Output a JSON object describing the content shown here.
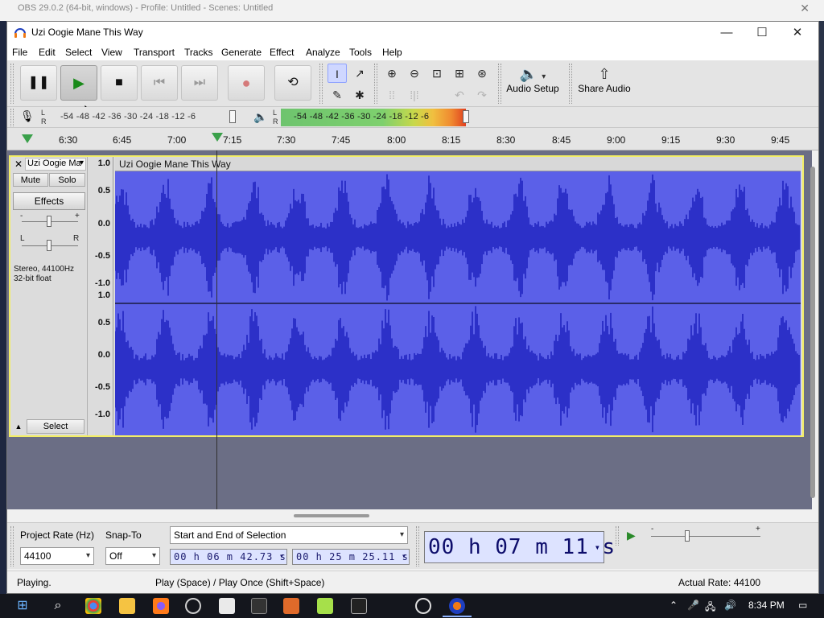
{
  "background": {
    "title": "OBS 29.0.2 (64-bit, windows) - Profile: Untitled - Scenes: Untitled",
    "close_glyph": "✕"
  },
  "window": {
    "title": "Uzi Oogie Mane This Way",
    "minimize": "—",
    "maximize": "☐",
    "close": "✕"
  },
  "menu": [
    "File",
    "Edit",
    "Select",
    "View",
    "Transport",
    "Tracks",
    "Generate",
    "Effect",
    "Analyze",
    "Tools",
    "Help"
  ],
  "transport": {
    "pause": "❚❚",
    "play": "▶",
    "stop": "■",
    "skip_start": "⏮",
    "skip_end": "⏭",
    "record": "●",
    "loop": "⟲"
  },
  "tools": {
    "select": "I",
    "envelope": "↗",
    "draw": "✎",
    "multi": "✱",
    "zoom_in": "⊕",
    "zoom_out": "⊖",
    "fit_selection": "⊡",
    "fit_project": "⊞",
    "zoom_toggle": "⊛",
    "trim": "⁞⁞",
    "silence": "⁞|⁞",
    "undo": "↶",
    "redo": "↷"
  },
  "audio_setup": {
    "icon": "🔈",
    "label": "Audio Setup",
    "arrow": "▾"
  },
  "share_audio": {
    "icon": "⇧",
    "label": "Share Audio"
  },
  "meters": {
    "record_scale": "-54  -48  -42  -36  -30  -24  -18  -12   -6",
    "play_scale": "-54  -48  -42  -36  -30  -24  -18  -12   -6",
    "mic_icon": "🎙",
    "speaker_icon": "🔈",
    "l": "L",
    "r": "R"
  },
  "ruler": {
    "labels": [
      "6:30",
      "6:45",
      "7:00",
      "7:15",
      "7:30",
      "7:45",
      "8:00",
      "8:15",
      "8:30",
      "8:45",
      "9:00",
      "9:15",
      "9:30",
      "9:45"
    ]
  },
  "track": {
    "close": "✕",
    "name": "Uzi Oogie Ma",
    "name_arrow": "▾",
    "mute": "Mute",
    "solo": "Solo",
    "effects": "Effects",
    "gain_minus": "-",
    "gain_plus": "+",
    "pan_l": "L",
    "pan_r": "R",
    "info_line1": "Stereo, 44100Hz",
    "info_line2": "32-bit float",
    "collapse": "▲",
    "select": "Select",
    "clip_name": "Uzi Oogie Mane This Way",
    "vruler_top": [
      "1.0",
      "0.5",
      "0.0",
      "-0.5",
      "-1.0"
    ],
    "vruler_bottom": [
      "1.0",
      "0.5",
      "0.0",
      "-0.5",
      "-1.0"
    ]
  },
  "selection_toolbar": {
    "project_rate_label": "Project Rate (Hz)",
    "project_rate_value": "44100",
    "snap_to_label": "Snap-To",
    "snap_to_value": "Off",
    "selection_mode": "Start and End of Selection",
    "start_time": "00 h 06 m 42.73 s",
    "end_time": "00 h 25 m 25.11 s",
    "current_time": "00 h 07 m 11 s",
    "dropdown_arrow": "▾",
    "play_at_speed": "▶",
    "speed_minus": "-",
    "speed_plus": "+"
  },
  "status": {
    "left": "Playing.",
    "middle": "Play (Space) / Play Once (Shift+Space)",
    "right": "Actual Rate: 44100"
  },
  "taskbar": {
    "start": "⊞",
    "search": "⌕",
    "apps": [
      "chrome-icon",
      "files-icon",
      "firefox-icon",
      "obs-icon",
      "store-icon",
      "terminal-icon",
      "app-icon",
      "notepad-icon",
      "7zip-icon",
      "xmind-icon",
      "player-icon",
      "audacity-icon"
    ],
    "tray": [
      "⌃",
      "🎤",
      "🖧",
      "🔊"
    ],
    "time": "8:34 PM",
    "notify": "▭"
  },
  "colors": {
    "waveform_bg": "#5b60e8",
    "waveform": "#2c30c8",
    "focus": "#f3ee66",
    "track_area": "#6b6e85"
  }
}
